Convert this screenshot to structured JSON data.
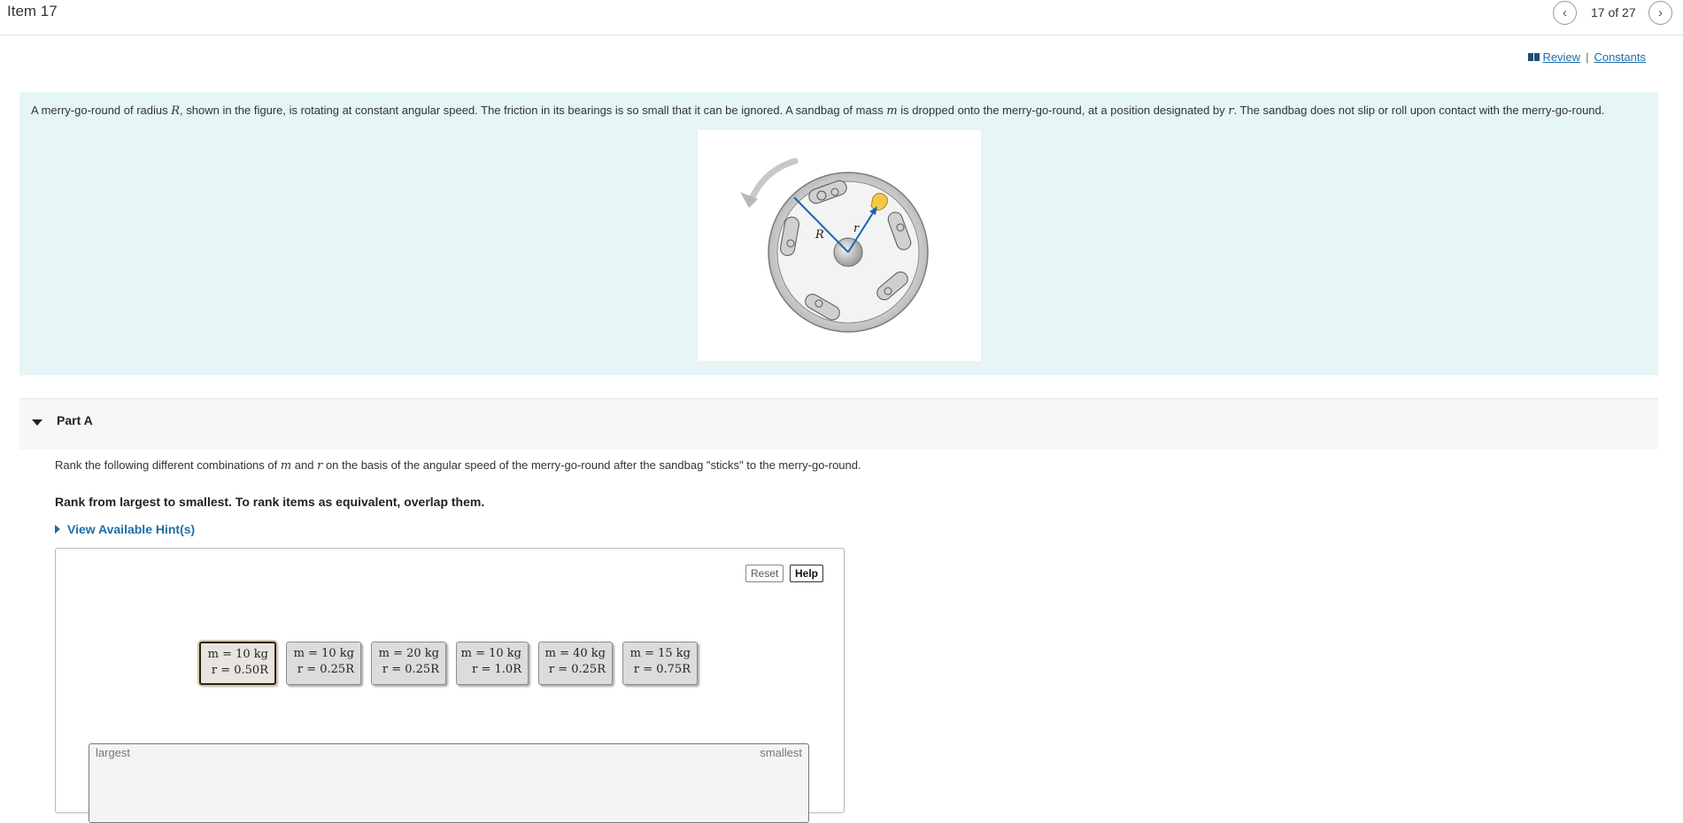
{
  "header": {
    "item_title": "Item 17",
    "prev_icon": "chevron-left-icon",
    "next_icon": "chevron-right-icon",
    "position": "17 of 27"
  },
  "links": {
    "review": "Review",
    "separator": "|",
    "constants": "Constants",
    "review_icon": "book-icon"
  },
  "intro": {
    "t1": "A merry-go-round of radius ",
    "v1": "R",
    "t2": ", shown in the figure, is rotating at constant angular speed. The friction in its bearings is so small that it can be ignored. A sandbag of mass ",
    "v2": "m",
    "t3": " is dropped onto the merry-go-round, at a position designated by ",
    "v3": "r",
    "t4": ". The sandbag does not slip or roll upon contact with the merry-go-round.",
    "figure_label_R": "R",
    "figure_label_r": "r"
  },
  "part": {
    "title": "Part A",
    "q1": "Rank the following different combinations of ",
    "qv1": "m",
    "q2": " and ",
    "qv2": "r",
    "q3": " on the basis of the angular speed of the merry-go-round after the sandbag \"sticks\" to the merry-go-round.",
    "instruction": "Rank from largest to smallest. To rank items as equivalent, overlap them.",
    "hints": "View Available Hint(s)"
  },
  "ranking": {
    "reset": "Reset",
    "help": "Help",
    "items": [
      {
        "m": "m = 10 kg",
        "r": "r = 0.50R"
      },
      {
        "m": "m = 10 kg",
        "r": "r = 0.25R"
      },
      {
        "m": "m = 20 kg",
        "r": "r = 0.25R"
      },
      {
        "m": "m = 10 kg",
        "r": "r = 1.0R"
      },
      {
        "m": "m = 40 kg",
        "r": "r = 0.25R"
      },
      {
        "m": "m = 15 kg",
        "r": "r = 0.75R"
      }
    ],
    "zone_left": "largest",
    "zone_right": "smallest"
  }
}
